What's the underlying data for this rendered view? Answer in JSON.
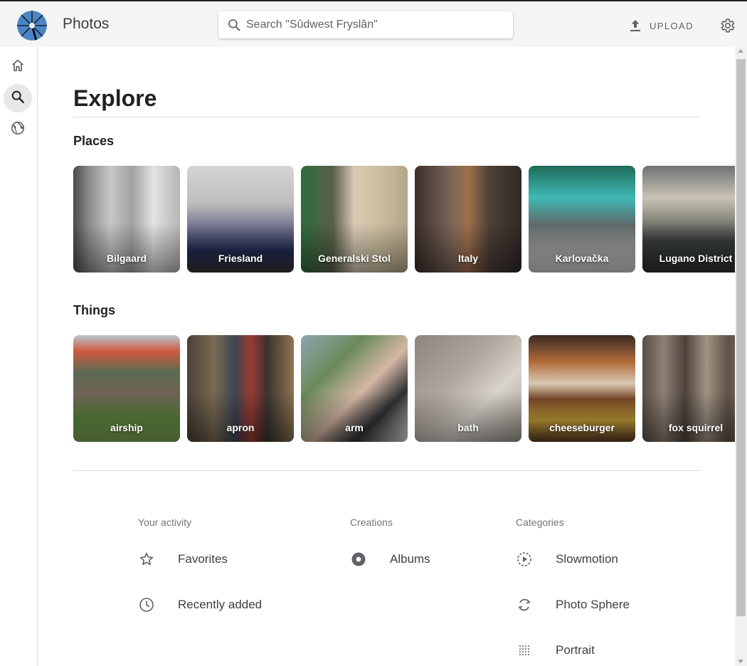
{
  "colors": {
    "topbar_bg": "#f5f5f5",
    "text": "#202124",
    "muted": "#5f6368",
    "divider": "#dadce0"
  },
  "header": {
    "app_title": "Photos",
    "search_placeholder": "Search \"Sûdwest Fryslân\"",
    "upload_label": "UPLOAD",
    "icons": {
      "search": "search-icon",
      "upload": "upload-icon",
      "settings": "gear-icon"
    }
  },
  "sidebar": {
    "items": [
      {
        "icon": "home-icon",
        "active": false
      },
      {
        "icon": "search-icon",
        "active": true
      },
      {
        "icon": "globe-icon",
        "active": false
      }
    ]
  },
  "page": {
    "title": "Explore"
  },
  "places": {
    "title": "Places",
    "items": [
      {
        "label": "Bilgaard"
      },
      {
        "label": "Friesland"
      },
      {
        "label": "Generalski Stol"
      },
      {
        "label": "Italy"
      },
      {
        "label": "Karlovačka"
      },
      {
        "label": "Lugano District"
      }
    ]
  },
  "things": {
    "title": "Things",
    "items": [
      {
        "label": "airship"
      },
      {
        "label": "apron"
      },
      {
        "label": "arm"
      },
      {
        "label": "bath"
      },
      {
        "label": "cheeseburger"
      },
      {
        "label": "fox squirrel"
      }
    ]
  },
  "footer": {
    "activity": {
      "title": "Your activity",
      "items": [
        {
          "label": "Favorites",
          "icon": "star-icon"
        },
        {
          "label": "Recently added",
          "icon": "clock-icon"
        }
      ]
    },
    "creations": {
      "title": "Creations",
      "items": [
        {
          "label": "Albums",
          "icon": "album-icon"
        }
      ]
    },
    "categories": {
      "title": "Categories",
      "items": [
        {
          "label": "Slowmotion",
          "icon": "slowmotion-icon"
        },
        {
          "label": "Photo Sphere",
          "icon": "photosphere-icon"
        },
        {
          "label": "Portrait",
          "icon": "portrait-icon"
        }
      ]
    }
  }
}
